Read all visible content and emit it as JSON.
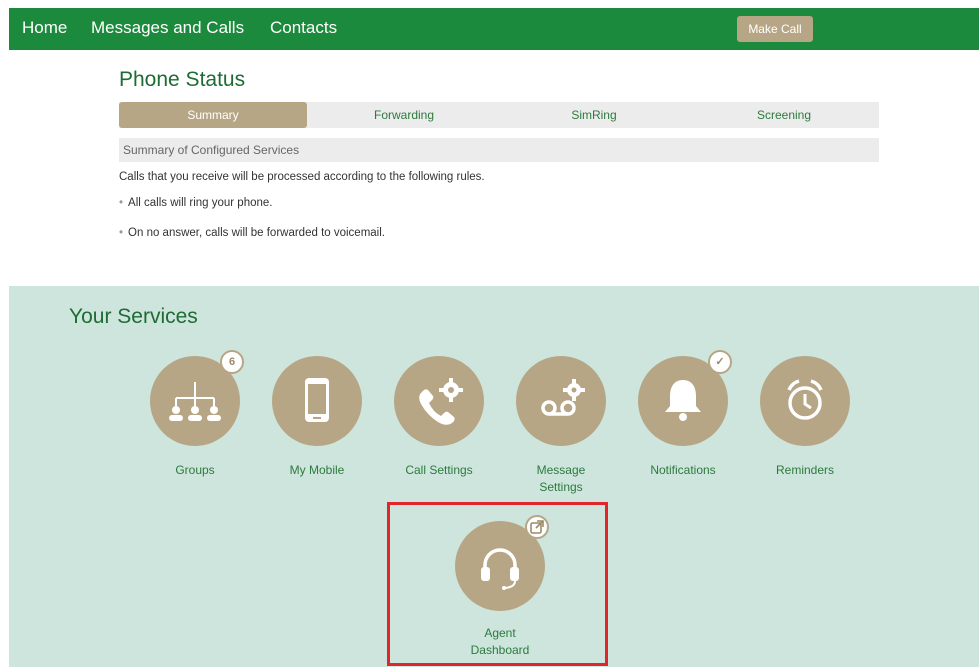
{
  "nav": {
    "home": "Home",
    "messages_calls": "Messages and Calls",
    "contacts": "Contacts",
    "make_call": "Make Call"
  },
  "phone_status": {
    "title": "Phone Status",
    "tabs": [
      {
        "label": "Summary",
        "active": true
      },
      {
        "label": "Forwarding",
        "active": false
      },
      {
        "label": "SimRing",
        "active": false
      },
      {
        "label": "Screening",
        "active": false
      }
    ],
    "section_title": "Summary of Configured Services",
    "intro": "Calls that you receive will be processed according to the following rules.",
    "rules": [
      "All calls will ring your phone.",
      "On no answer, calls will be forwarded to voicemail."
    ]
  },
  "services": {
    "title": "Your Services",
    "items": [
      {
        "label": "Groups",
        "icon": "groups-icon",
        "badge": "6"
      },
      {
        "label": "My Mobile",
        "icon": "mobile-phone-icon"
      },
      {
        "label": "Call Settings",
        "icon": "phone-gear-icon"
      },
      {
        "label": "Message Settings",
        "icon": "voicemail-gear-icon"
      },
      {
        "label": "Notifications",
        "icon": "bell-icon",
        "badge": "✓"
      },
      {
        "label": "Reminders",
        "icon": "alarm-clock-icon"
      },
      {
        "label": "Agent Dashboard",
        "icon": "headset-icon",
        "badge": "external-link-icon"
      }
    ]
  },
  "colors": {
    "nav_green": "#1c8a3c",
    "title_green": "#1f6b34",
    "tan": "#b6a685",
    "services_bg": "#cde5dc",
    "highlight_red": "#e0262b"
  }
}
